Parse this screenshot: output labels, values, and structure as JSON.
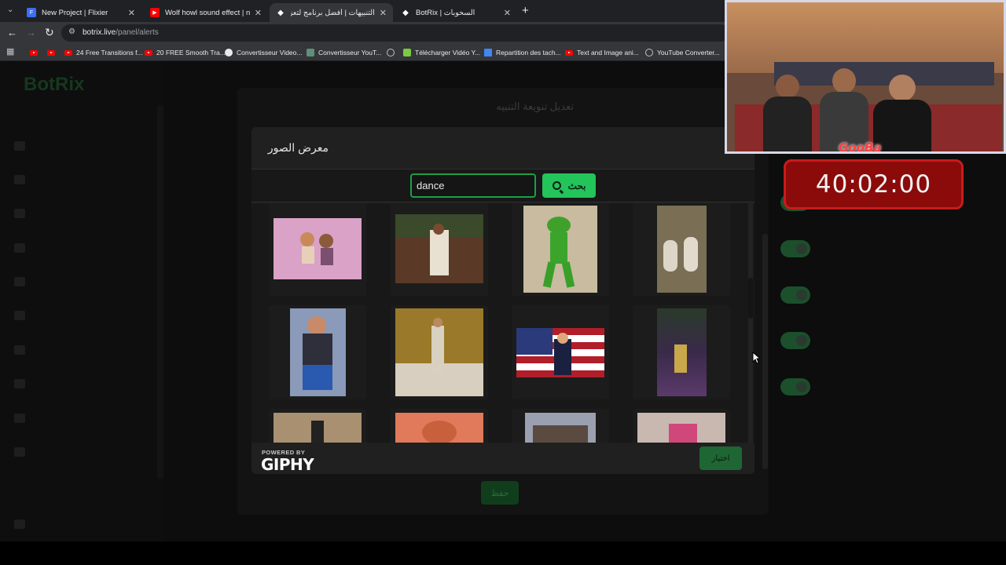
{
  "browser": {
    "tabs": [
      {
        "title": "New Project | Flixier",
        "active": false,
        "icon": "flixier-icon",
        "icon_color": "#3b6ef5"
      },
      {
        "title": "Wolf howl sound effect | night",
        "active": false,
        "icon": "youtube-icon",
        "icon_color": "#ff0000"
      },
      {
        "title": "التنبيهات | أفضل برنامج لتعزيز ال",
        "active": true,
        "icon": "botrix-icon",
        "icon_color": "#ffffff"
      },
      {
        "title": "BotRix | السحوبات",
        "active": false,
        "icon": "botrix-icon",
        "icon_color": "#ffffff"
      }
    ],
    "new_tab": "+",
    "url_domain": "botrix.live",
    "url_path": "/panel/alerts",
    "bookmarks": [
      {
        "label": "",
        "icon": "youtube-icon"
      },
      {
        "label": "",
        "icon": "youtube-icon"
      },
      {
        "label": "24 Free Transitions f...",
        "icon": "youtube-icon"
      },
      {
        "label": "20 FREE Smooth Tra...",
        "icon": "youtube-icon"
      },
      {
        "label": "Convertisseur Video...",
        "icon": "google-icon"
      },
      {
        "label": "Convertisseur YouT...",
        "icon": "converter-icon"
      },
      {
        "label": "",
        "icon": "globe-icon"
      },
      {
        "label": "Télécharger Vidéo Y...",
        "icon": "download-icon"
      },
      {
        "label": "Repartition des tach...",
        "icon": "docs-icon"
      },
      {
        "label": "Text and Image ani...",
        "icon": "youtube-icon"
      },
      {
        "label": "YouTube Converter...",
        "icon": "globe-icon"
      }
    ]
  },
  "background_page": {
    "panel_title": "تعديل تنويعة التنبيه",
    "save_label": "حفظ"
  },
  "modal": {
    "title": "معرض الصور",
    "search": {
      "value": "dance",
      "button_label": "بحث"
    },
    "gifs": [
      {
        "name": "gif-cartoon-dance"
      },
      {
        "name": "gif-man-dancing-christmas"
      },
      {
        "name": "gif-kermit-dance"
      },
      {
        "name": "gif-cats-dance"
      },
      {
        "name": "gif-boy-dance"
      },
      {
        "name": "gif-man-suit-dance"
      },
      {
        "name": "gif-flag-dance"
      },
      {
        "name": "gif-dancer-purple"
      },
      {
        "name": "gif-row3-1"
      },
      {
        "name": "gif-row3-2"
      },
      {
        "name": "gif-row3-3"
      },
      {
        "name": "gif-row3-4"
      }
    ],
    "footer": {
      "powered_by": "POWERED BY",
      "giphy": "GIPHY",
      "choose_label": "اختيار"
    }
  },
  "overlay": {
    "timer": "40:02:00",
    "webcam_label": "GooBa"
  },
  "colors": {
    "accent": "#23c45a",
    "timer_bg": "#8b0b0b"
  }
}
